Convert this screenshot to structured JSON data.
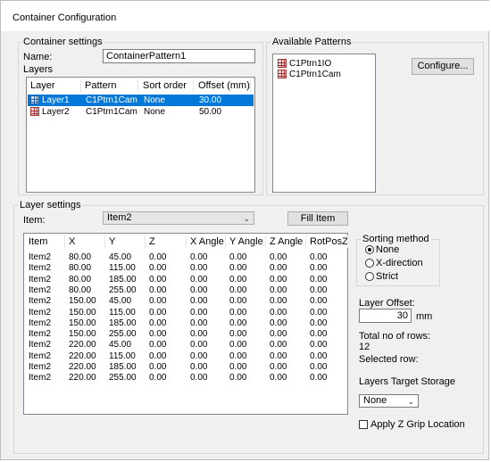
{
  "window": {
    "title": "Container Configuration"
  },
  "container_settings": {
    "legend": "Container settings",
    "name_label": "Name:",
    "name_value": "ContainerPattern1",
    "layers_label": "Layers",
    "layers_columns": [
      "Layer",
      "Pattern",
      "Sort order",
      "Offset (mm)"
    ],
    "layers_rows": [
      {
        "layer": "Layer1",
        "pattern": "C1Ptrn1Cam",
        "sort": "None",
        "offset": "30.00",
        "selected": true
      },
      {
        "layer": "Layer2",
        "pattern": "C1Ptrn1Cam",
        "sort": "None",
        "offset": "50.00",
        "selected": false
      }
    ]
  },
  "available_patterns": {
    "legend": "Available Patterns",
    "items": [
      "C1Ptrn1IO",
      "C1Ptrn1Cam"
    ],
    "configure_label": "Configure..."
  },
  "layer_settings": {
    "legend": "Layer settings",
    "item_label": "Item:",
    "item_value": "Item2",
    "fill_item_label": "Fill Item",
    "columns": [
      "Item",
      "X",
      "Y",
      "Z",
      "X Angle",
      "Y Angle",
      "Z Angle",
      "RotPosZ"
    ],
    "rows": [
      [
        "Item2",
        "80.00",
        "45.00",
        "0.00",
        "0.00",
        "0.00",
        "0.00",
        "0.00"
      ],
      [
        "Item2",
        "80.00",
        "115.00",
        "0.00",
        "0.00",
        "0.00",
        "0.00",
        "0.00"
      ],
      [
        "Item2",
        "80.00",
        "185.00",
        "0.00",
        "0.00",
        "0.00",
        "0.00",
        "0.00"
      ],
      [
        "Item2",
        "80.00",
        "255.00",
        "0.00",
        "0.00",
        "0.00",
        "0.00",
        "0.00"
      ],
      [
        "Item2",
        "150.00",
        "45.00",
        "0.00",
        "0.00",
        "0.00",
        "0.00",
        "0.00"
      ],
      [
        "Item2",
        "150.00",
        "115.00",
        "0.00",
        "0.00",
        "0.00",
        "0.00",
        "0.00"
      ],
      [
        "Item2",
        "150.00",
        "185.00",
        "0.00",
        "0.00",
        "0.00",
        "0.00",
        "0.00"
      ],
      [
        "Item2",
        "150.00",
        "255.00",
        "0.00",
        "0.00",
        "0.00",
        "0.00",
        "0.00"
      ],
      [
        "Item2",
        "220.00",
        "45.00",
        "0.00",
        "0.00",
        "0.00",
        "0.00",
        "0.00"
      ],
      [
        "Item2",
        "220.00",
        "115.00",
        "0.00",
        "0.00",
        "0.00",
        "0.00",
        "0.00"
      ],
      [
        "Item2",
        "220.00",
        "185.00",
        "0.00",
        "0.00",
        "0.00",
        "0.00",
        "0.00"
      ],
      [
        "Item2",
        "220.00",
        "255.00",
        "0.00",
        "0.00",
        "0.00",
        "0.00",
        "0.00"
      ]
    ],
    "sorting": {
      "legend": "Sorting method",
      "options": [
        "None",
        "X-direction",
        "Strict"
      ],
      "selected": "None"
    },
    "layer_offset_label": "Layer Offset:",
    "layer_offset_value": "30",
    "layer_offset_unit": "mm",
    "total_rows_label": "Total no of rows:",
    "total_rows_value": "12",
    "selected_row_label": "Selected row:",
    "target_storage_label": "Layers Target Storage",
    "target_storage_value": "None",
    "apply_z_grip_label": "Apply Z Grip Location",
    "apply_z_grip_checked": false
  }
}
